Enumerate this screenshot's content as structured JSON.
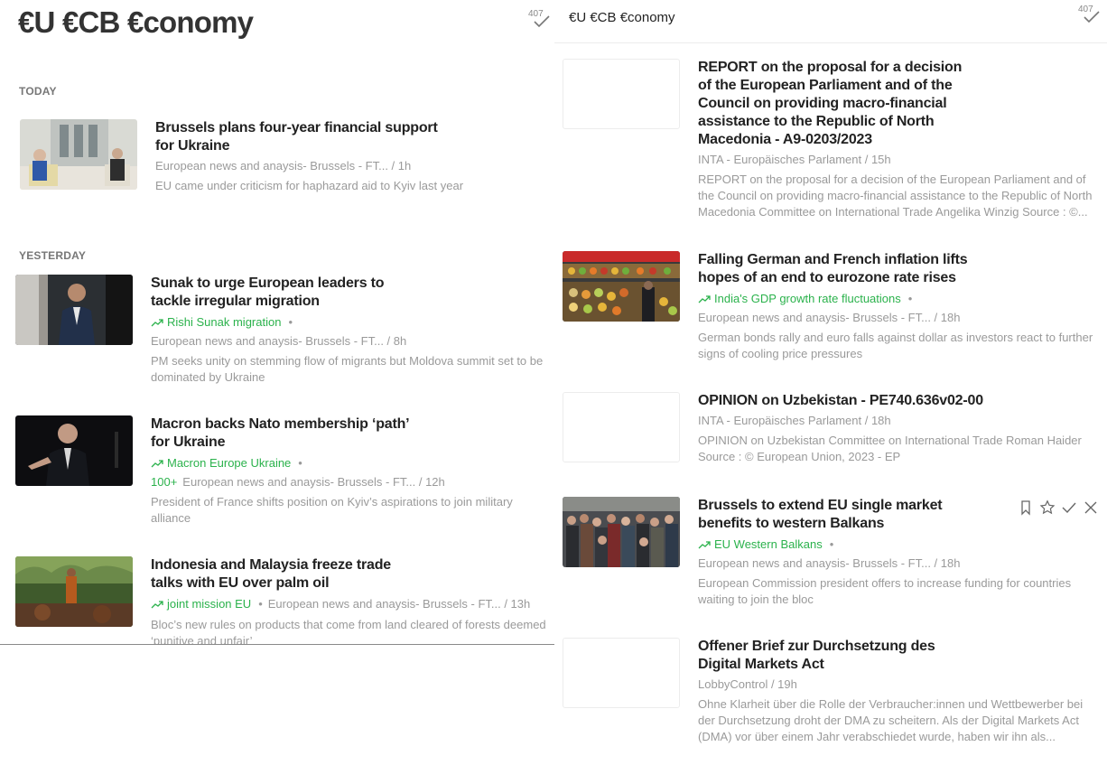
{
  "left": {
    "feed_title": "€U €CB €conomy",
    "unread_count": "407",
    "sections": {
      "today": "TODAY",
      "yesterday": "YESTERDAY"
    },
    "articles": [
      {
        "headline": "Brussels plans four-year financial support for Ukraine",
        "meta": "European news and anaysis- Brussels - FT... / 1h",
        "summary": "EU came under criticism for haphazard aid to Kyiv last year"
      },
      {
        "headline": "Sunak to urge European leaders to tackle irregular migration",
        "trend": "Rishi Sunak migration",
        "meta": "European news and anaysis- Brussels - FT... / 8h",
        "summary": "PM seeks unity on stemming flow of migrants but Moldova summit set to be dominated by Ukraine"
      },
      {
        "headline": "Macron backs Nato membership ‘path’ for Ukraine",
        "trend": "Macron Europe Ukraine",
        "popularity": "100+",
        "meta": "European news and anaysis- Brussels - FT... / 12h",
        "summary": "President of France shifts position on Kyiv’s aspirations to join military alliance"
      },
      {
        "headline": "Indonesia and Malaysia freeze trade talks with EU over palm oil",
        "trend": "joint mission EU",
        "meta": "European news and anaysis- Brussels - FT... / 13h",
        "summary": "Bloc’s new rules on products that come from land cleared of forests deemed ‘punitive and unfair’"
      }
    ]
  },
  "right": {
    "feed_title": "€U €CB €conomy",
    "unread_count": "407",
    "articles": [
      {
        "headline": "REPORT on the proposal for a decision of the European Parliament and of the Council on providing macro-financial assistance to the Republic of North Macedonia - A9-0203/2023",
        "meta": "INTA - Europäisches Parlament / 15h",
        "summary": "REPORT on the proposal for a decision of the European Parliament and of the Council on providing macro-financial assistance to the Republic of North Macedonia Committee on International Trade Angelika Winzig Source : ©..."
      },
      {
        "headline": "Falling German and French inflation lifts hopes of an end to eurozone rate rises",
        "trend": "India's GDP growth rate fluctuations",
        "meta": "European news and anaysis- Brussels - FT... / 18h",
        "summary": "German bonds rally and euro falls against dollar as investors react to further signs of cooling price pressures"
      },
      {
        "headline": "OPINION on Uzbekistan - PE740.636v02-00",
        "meta": "INTA - Europäisches Parlament / 18h",
        "summary": "OPINION on Uzbekistan Committee on International Trade Roman Haider Source : © European Union, 2023 - EP"
      },
      {
        "headline": "Brussels to extend EU single market benefits to western Balkans",
        "trend": "EU Western Balkans",
        "meta": "European news and anaysis- Brussels - FT... / 18h",
        "summary": "European Commission president offers to increase funding for countries waiting to join the bloc"
      },
      {
        "headline": "Offener Brief zur Durchsetzung des Digital Markets Act",
        "meta": "LobbyControl / 19h",
        "summary": "Ohne Klarheit über die Rolle der Verbraucher:innen und Wettbewerber bei der Durchsetzung droht der DMA zu scheitern. Als der Digital Markets Act (DMA) vor über einem Jahr verabschiedet wurde, haben wir ihn als..."
      }
    ]
  },
  "colors": {
    "trend_green": "#2bb24c",
    "meta_gray": "#9a9a9a",
    "headline": "#222222"
  },
  "icons": [
    "checkmark-icon",
    "trend-up-icon",
    "bookmark-icon",
    "star-icon",
    "close-icon"
  ]
}
